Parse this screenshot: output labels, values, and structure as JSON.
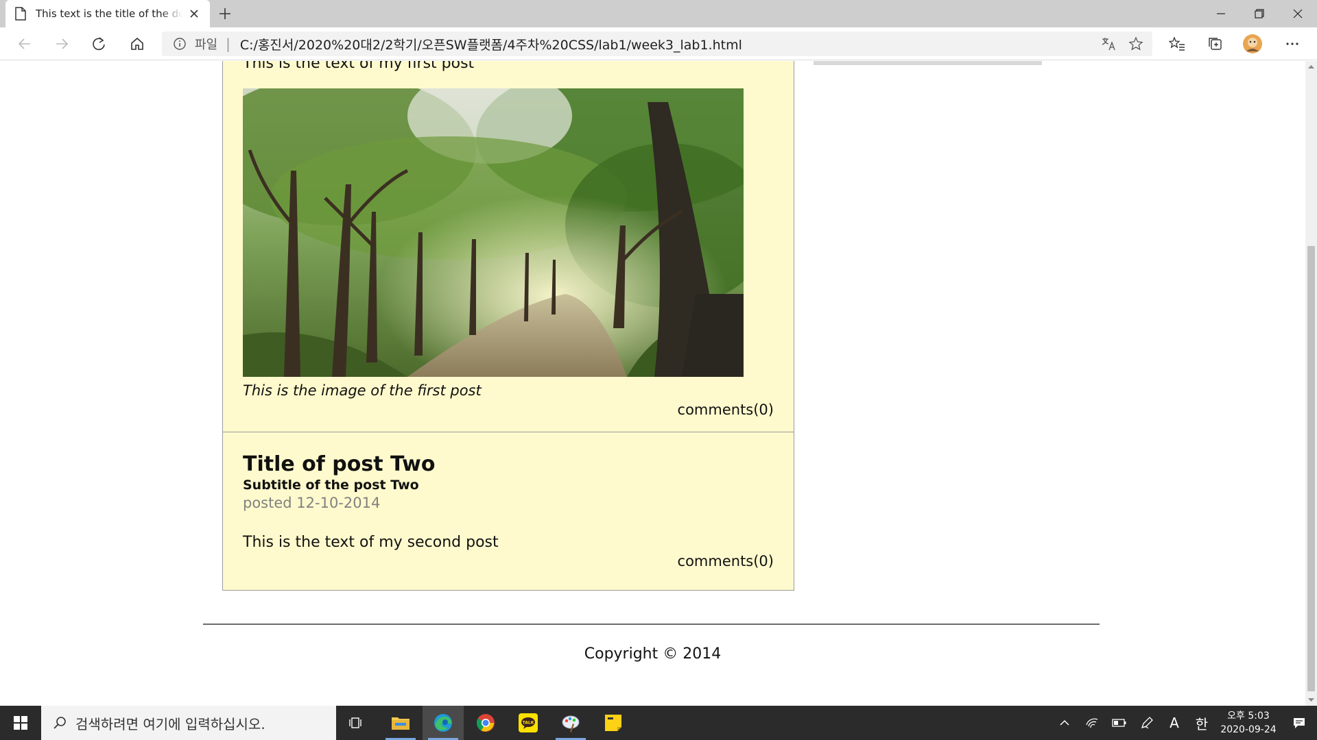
{
  "browser": {
    "tab_title": "This text is the title of the document",
    "address_label": "파일",
    "address_separator": "|",
    "url": "C:/홍진서/2020%20대2/2학기/오픈SW플랫폼/4주차%20CSS/lab1/week3_lab1.html",
    "icons": [
      "page-icon",
      "close-icon",
      "plus-icon",
      "minimize-icon",
      "restore-icon",
      "close-window-icon",
      "back-arrow-icon",
      "forward-arrow-icon",
      "refresh-icon",
      "home-icon",
      "info-icon",
      "translate-icon",
      "star-icon",
      "favorites-icon",
      "collections-icon",
      "profile-avatar",
      "more-icon"
    ]
  },
  "page": {
    "post1": {
      "text": "This is the text of my first post",
      "image_caption": "This is the image of the first post",
      "comments": "comments(0)"
    },
    "post2": {
      "title": "Title of post Two",
      "subtitle": "Subtitle of the post Two",
      "posted": "posted 12-10-2014",
      "text": "This is the text of my second post",
      "comments": "comments(0)"
    },
    "footer": "Copyright © 2014",
    "colors": {
      "post_background": "#fffacd",
      "post_border": "#9a9a9a",
      "posted_text": "#808080",
      "footer_rule": "#6b6b6b"
    }
  },
  "taskbar": {
    "search_placeholder": "검색하려면 여기에 입력하십시오.",
    "clock_period_time": "오후 5:03",
    "clock_date": "2020-09-24",
    "ime_letter": "A",
    "ime_lang": "한",
    "apps": [
      "task-view-icon",
      "file-explorer-icon",
      "edge-icon",
      "chrome-icon",
      "kakaotalk-icon",
      "paint-icon",
      "sticky-notes-icon"
    ]
  }
}
